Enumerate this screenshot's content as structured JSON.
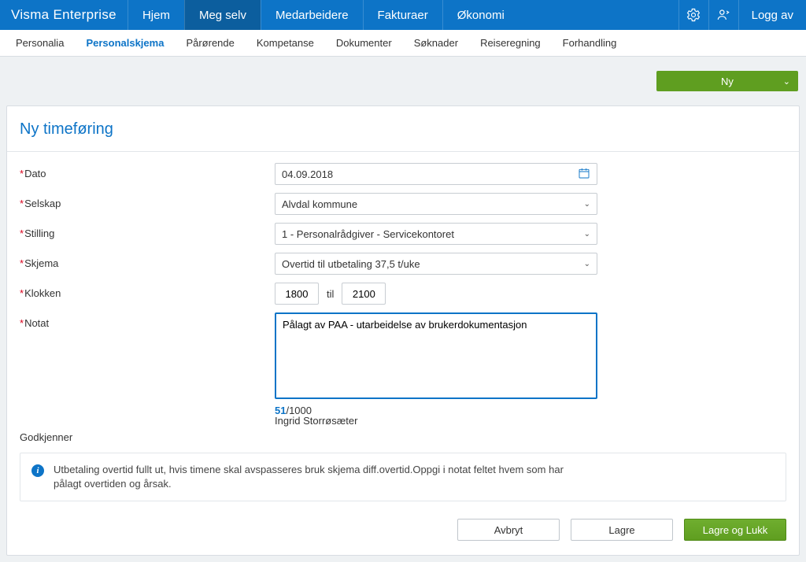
{
  "topbar": {
    "brand": "Visma Enterprise",
    "items": [
      {
        "label": "Hjem",
        "active": false
      },
      {
        "label": "Meg selv",
        "active": true
      },
      {
        "label": "Medarbeidere",
        "active": false
      },
      {
        "label": "Fakturaer",
        "active": false
      },
      {
        "label": "Økonomi",
        "active": false
      }
    ],
    "logoff": "Logg av"
  },
  "subtabs": [
    {
      "label": "Personalia",
      "active": false
    },
    {
      "label": "Personalskjema",
      "active": true
    },
    {
      "label": "Pårørende",
      "active": false
    },
    {
      "label": "Kompetanse",
      "active": false
    },
    {
      "label": "Dokumenter",
      "active": false
    },
    {
      "label": "Søknader",
      "active": false
    },
    {
      "label": "Reiseregning",
      "active": false
    },
    {
      "label": "Forhandling",
      "active": false
    }
  ],
  "nybutton": "Ny",
  "panel": {
    "title": "Ny timeføring"
  },
  "form": {
    "dato": {
      "label": "Dato",
      "value": "04.09.2018"
    },
    "selskap": {
      "label": "Selskap",
      "value": "Alvdal kommune"
    },
    "stilling": {
      "label": "Stilling",
      "value": "1 - Personalrådgiver - Servicekontoret"
    },
    "skjema": {
      "label": "Skjema",
      "value": "Overtid til utbetaling 37,5 t/uke"
    },
    "klokken": {
      "label": "Klokken",
      "from": "1800",
      "til_label": "til",
      "to": "2100"
    },
    "notat": {
      "label": "Notat",
      "value": "Pålagt av PAA - utarbeidelse av brukerdokumentasjon",
      "used": "51",
      "sep_max": "/1000"
    },
    "godkjenner": {
      "label": "Godkjenner",
      "value": "Ingrid Storrøsæter"
    }
  },
  "info": "Utbetaling overtid fullt ut, hvis timene skal avspasseres bruk skjema diff.overtid.Oppgi i notat feltet hvem som har pålagt overtiden og årsak.",
  "actions": {
    "cancel": "Avbryt",
    "save": "Lagre",
    "saveclose": "Lagre og Lukk"
  }
}
